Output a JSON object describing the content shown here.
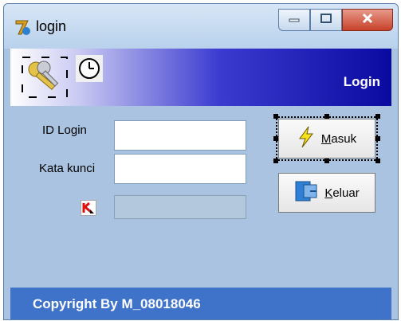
{
  "window": {
    "title": "login"
  },
  "header": {
    "title": "Login"
  },
  "form": {
    "id_label": "ID Login",
    "id_value": "",
    "password_label": "Kata kunci",
    "password_value": ""
  },
  "buttons": {
    "masuk_prefix": "",
    "masuk_underline": "M",
    "masuk_rest": "asuk",
    "keluar_underline": "K",
    "keluar_rest": "eluar"
  },
  "footer": {
    "text": "Copyright By M_08018046"
  },
  "icons": {
    "app": "app-icon",
    "keys": "keys-icon",
    "clock": "clock-icon",
    "kaspersky": "kaspersky-icon",
    "lightning": "lightning-icon",
    "exit": "exit-icon",
    "minimize": "minimize-icon",
    "maximize": "maximize-icon",
    "close": "close-icon"
  },
  "colors": {
    "footer": "#3f73c9",
    "content": "#a9c3e0",
    "header_dark": "#0a0aa0"
  }
}
